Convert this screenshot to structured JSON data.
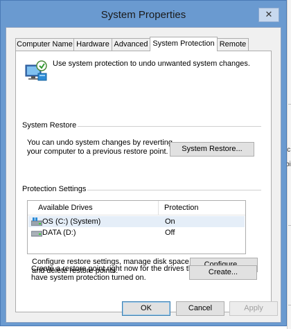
{
  "window": {
    "title": "System Properties",
    "close_glyph": "✕"
  },
  "tabs": [
    {
      "label": "Computer Name",
      "active": false
    },
    {
      "label": "Hardware",
      "active": false
    },
    {
      "label": "Advanced",
      "active": false
    },
    {
      "label": "System Protection",
      "active": true
    },
    {
      "label": "Remote",
      "active": false
    }
  ],
  "intro": {
    "icon": "system-protection-icon",
    "text": "Use system protection to undo unwanted system changes."
  },
  "system_restore": {
    "group_label": "System Restore",
    "description_line1": "You can undo system changes by reverting",
    "description_line2": "your computer to a previous restore point.",
    "button_label": "System Restore..."
  },
  "protection_settings": {
    "group_label": "Protection Settings",
    "columns": [
      "Available Drives",
      "Protection"
    ],
    "drives": [
      {
        "name": "OS (C:) (System)",
        "protection": "On",
        "icon": "system-drive-icon"
      },
      {
        "name": "DATA (D:)",
        "protection": "Off",
        "icon": "hard-drive-icon"
      }
    ],
    "configure_line1": "Configure restore settings, manage disk space,",
    "configure_line2": "and delete restore points.",
    "configure_button": "Configure...",
    "create_line1": "Create a restore point right now for the drives that",
    "create_line2": "have system protection turned on.",
    "create_button": "Create..."
  },
  "footer": {
    "ok": "OK",
    "cancel": "Cancel",
    "apply": "Apply"
  },
  "colors": {
    "window_frame": "#6a9ad0",
    "dialog_background": "#f0f0f0",
    "selected_row": "#e5eef8"
  },
  "background_window_chars": [
    "ic",
    "bi"
  ]
}
